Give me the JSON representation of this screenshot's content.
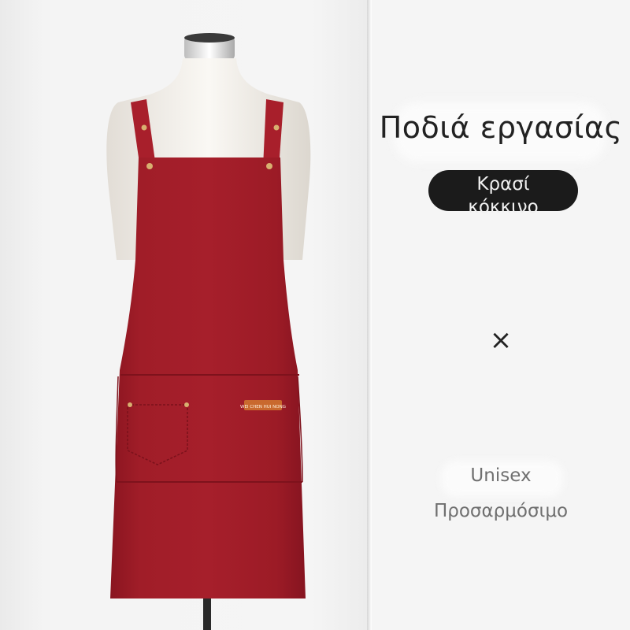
{
  "product": {
    "title": "Ποδιά εργασίας",
    "color_label": "Κρασί\nκόκκινο",
    "times_symbol": "×",
    "features": [
      "Unisex",
      "Προσαρμόσιμο"
    ],
    "brand_tag": "WEI CHEN HUI NONG"
  },
  "colors": {
    "apron": "#9e1b26",
    "strap": "#a81f2b",
    "badge": "#1b1b1b",
    "tag": "#c9692e"
  },
  "icons": [
    "times-icon"
  ]
}
